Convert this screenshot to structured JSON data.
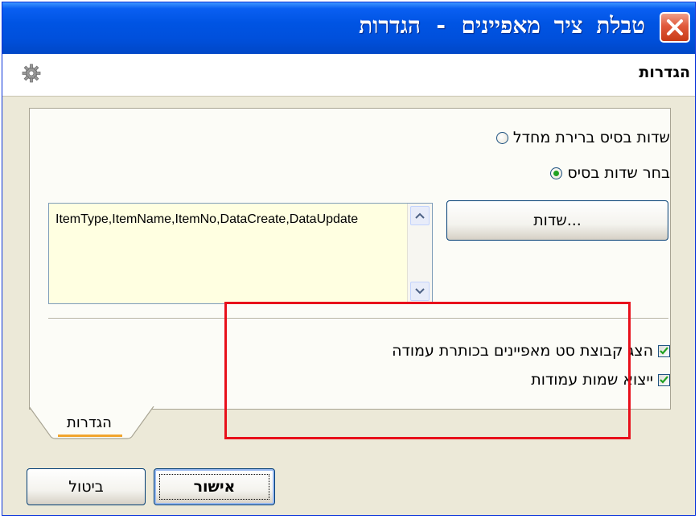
{
  "window": {
    "title": "טבלת ציר מאפיינים - הגדרות"
  },
  "header": {
    "title": "הגדרות"
  },
  "options": {
    "radio_default_fields": "שדות בסיס ברירת מחדל",
    "radio_choose_fields": "בחר שדות בסיס",
    "selected_radio": "radio_choose_fields",
    "fields_button_label": "שדות...",
    "fields_value": "ItemType,ItemName,ItemNo,DataCreate,DataUpdate",
    "check_show_group": "הצג קבוצת סט מאפיינים בכותרת עמודה",
    "check_show_group_checked": true,
    "check_export_names": "ייצוא שמות עמודות",
    "check_export_names_checked": true
  },
  "tabs": [
    {
      "label": "הגדרות",
      "active": true
    }
  ],
  "buttons": {
    "ok_label": "אישור",
    "cancel_label": "ביטול"
  },
  "colors": {
    "titlebar": "#0054e3",
    "highlight_box": "#e8101b",
    "textbox_bg": "#ffffe1",
    "dialog_bg": "#ece9d8"
  }
}
